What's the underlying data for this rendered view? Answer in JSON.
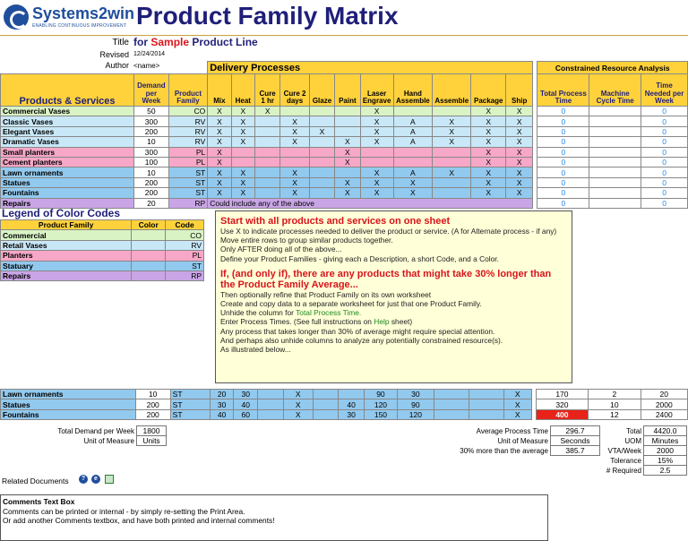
{
  "brand": {
    "name": "Systems2win",
    "tagline": "ENABLING CONTINUOUS IMPROVEMENT"
  },
  "title": "Product Family Matrix",
  "meta": {
    "title_label": "Title",
    "title_prefix": "for",
    "title_sample": "Sample",
    "title_rest": "Product Line",
    "revised_label": "Revised",
    "revised_value": "12/24/2014",
    "author_label": "Author",
    "author_value": "<name>"
  },
  "headers": {
    "products": "Products & Services",
    "demand": "Demand per Week",
    "family": "Product Family",
    "delivery": "Delivery Processes",
    "constrained": "Constrained Resource Analysis",
    "processes": [
      "Mix",
      "Heat",
      "Cure 1 hr",
      "Cure 2 days",
      "Glaze",
      "Paint",
      "Laser Engrave",
      "Hand Assemble",
      "Assemble",
      "Package",
      "Ship"
    ],
    "total_time": "Total Process Time",
    "machine_cycle": "Machine Cycle Time",
    "time_needed": "Time Needed per Week"
  },
  "products": [
    {
      "name": "Commercial Vases",
      "demand": "50",
      "code": "CO",
      "marks": [
        "X",
        "X",
        "X",
        "",
        "",
        "",
        "X",
        "",
        "",
        "X",
        "X"
      ],
      "t": "0",
      "n": "0"
    },
    {
      "name": "Classic Vases",
      "demand": "300",
      "code": "RV",
      "marks": [
        "X",
        "X",
        "",
        "X",
        "",
        "",
        "X",
        "A",
        "X",
        "X",
        "X"
      ],
      "t": "0",
      "n": "0"
    },
    {
      "name": "Elegant Vases",
      "demand": "200",
      "code": "RV",
      "marks": [
        "X",
        "X",
        "",
        "X",
        "X",
        "",
        "X",
        "A",
        "X",
        "X",
        "X"
      ],
      "t": "0",
      "n": "0"
    },
    {
      "name": "Dramatic Vases",
      "demand": "10",
      "code": "RV",
      "marks": [
        "X",
        "X",
        "",
        "X",
        "",
        "X",
        "X",
        "A",
        "X",
        "X",
        "X"
      ],
      "t": "0",
      "n": "0"
    },
    {
      "name": "Small planters",
      "demand": "300",
      "code": "PL",
      "marks": [
        "X",
        "",
        "",
        "",
        "",
        "X",
        "",
        "",
        "",
        "X",
        "X"
      ],
      "t": "0",
      "n": "0"
    },
    {
      "name": "Cement planters",
      "demand": "100",
      "code": "PL",
      "marks": [
        "X",
        "",
        "",
        "",
        "",
        "X",
        "",
        "",
        "",
        "X",
        "X"
      ],
      "t": "0",
      "n": "0"
    },
    {
      "name": "Lawn ornaments",
      "demand": "10",
      "code": "ST",
      "marks": [
        "X",
        "X",
        "",
        "X",
        "",
        "",
        "X",
        "A",
        "X",
        "X",
        "X"
      ],
      "t": "0",
      "n": "0"
    },
    {
      "name": "Statues",
      "demand": "200",
      "code": "ST",
      "marks": [
        "X",
        "X",
        "",
        "X",
        "",
        "X",
        "X",
        "X",
        "",
        "X",
        "X"
      ],
      "t": "0",
      "n": "0"
    },
    {
      "name": "Fountains",
      "demand": "200",
      "code": "ST",
      "marks": [
        "X",
        "X",
        "",
        "X",
        "",
        "X",
        "X",
        "X",
        "",
        "X",
        "X"
      ],
      "t": "0",
      "n": "0"
    },
    {
      "name": "Repairs",
      "demand": "20",
      "code": "RP",
      "note": "Could include any of the above",
      "t": "0",
      "n": "0"
    }
  ],
  "legend": {
    "title": "Legend of Color Codes",
    "headers": [
      "Product Family",
      "Color",
      "Code"
    ],
    "rows": [
      {
        "name": "Commercial",
        "code": "CO"
      },
      {
        "name": "Retail Vases",
        "code": "RV"
      },
      {
        "name": "Planters",
        "code": "PL"
      },
      {
        "name": "Statuary",
        "code": "ST"
      },
      {
        "name": "Repairs",
        "code": "RP"
      }
    ]
  },
  "notes": {
    "heading1": "Start with all products and services on one sheet",
    "lines1": [
      "Use X to indicate processes needed to deliver the product or service. (A for Alternate process - if any)",
      "Move entire rows to group similar products together.",
      "Only AFTER doing all of the above...",
      "Define your Product Families  - giving each a Description, a short Code, and a Color."
    ],
    "heading2": "If, (and only if), there are any products that might take 30% longer than the Product Family Average...",
    "lines2a": [
      "Then optionally refine that Product Family on its own worksheet",
      "Create and copy data to a separate worksheet for just that one Product Family."
    ],
    "unhide_pre": "Unhide the column for",
    "unhide_link": "Total Process Time.",
    "enter_pre": "Enter Process Times. (See full instructions on",
    "enter_link": "Help",
    "enter_post": "sheet)",
    "lines2b": [
      "Any process that takes longer than 30% of average might require special attention.",
      "And perhaps also unhide columns to analyze any potentially constrained resource(s).",
      "As illustrated below..."
    ]
  },
  "detail": {
    "rows": [
      {
        "name": "Lawn ornaments",
        "demand": "10",
        "code": "ST",
        "vals": [
          "20",
          "30",
          "",
          "X",
          "",
          "",
          "90",
          "30",
          "",
          "",
          "X"
        ],
        "total": "170",
        "machine": "2",
        "needed": "20"
      },
      {
        "name": "Statues",
        "demand": "200",
        "code": "ST",
        "vals": [
          "30",
          "40",
          "",
          "X",
          "",
          "40",
          "120",
          "90",
          "",
          "",
          "X"
        ],
        "total": "320",
        "machine": "10",
        "needed": "2000"
      },
      {
        "name": "Fountains",
        "demand": "200",
        "code": "ST",
        "vals": [
          "40",
          "60",
          "",
          "X",
          "",
          "30",
          "150",
          "120",
          "",
          "",
          "X"
        ],
        "total": "400",
        "machine": "12",
        "needed": "2400"
      }
    ]
  },
  "summary": {
    "total_demand_label": "Total Demand per Week",
    "total_demand": "1800",
    "uom_label": "Unit of Measure",
    "uom": "Units",
    "avg_time_label": "Average Process Time",
    "avg_time": "296.7",
    "uom2_label": "Unit of Measure",
    "uom2": "Seconds",
    "pct_label": "30% more than the average",
    "pct": "385.7",
    "total_label": "Total",
    "total": "4420.0",
    "uom3_label": "UOM",
    "uom3": "Minutes",
    "vta_label": "VTA/Week",
    "vta": "2000",
    "tol_label": "Tolerance",
    "tol": "15%",
    "req_label": "# Required",
    "req": "2.5"
  },
  "related": "Related Documents",
  "comments": {
    "title": "Comments Text Box",
    "lines": [
      "Comments  can be printed or internal - by simply re-setting the Print Area.",
      "Or add another Comments  textbox, and have both printed and internal comments!"
    ]
  },
  "colors": {
    "header_yellow": "#ffd23c",
    "commercial": "#d9f3c5",
    "retail": "#c8e7f7",
    "planters": "#f7a7c7",
    "statuary": "#92c9ee",
    "repairs": "#c9a5e6",
    "alert": "#e8231a"
  }
}
